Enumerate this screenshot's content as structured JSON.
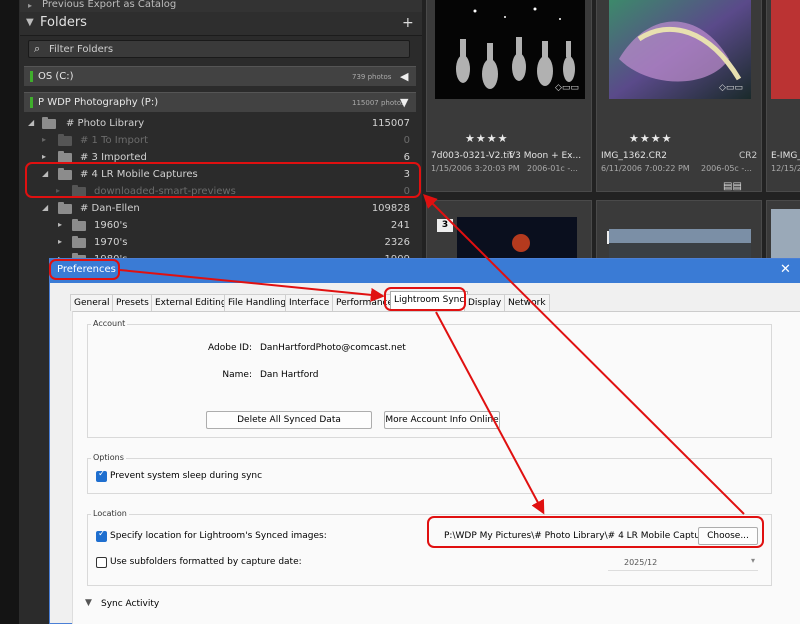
{
  "left_panel": {
    "prev_item": "Previous Export as Catalog",
    "folders_header": {
      "title": "Folders",
      "add_icon": "plus-icon"
    },
    "filter": {
      "placeholder": "Filter Folders",
      "icon": "search-icon"
    },
    "volumes": [
      {
        "name": "OS (C:)",
        "count": "739 photos",
        "led_color": "#3fae2c"
      },
      {
        "name": "P WDP Photography (P:)",
        "count": "115007 photos",
        "led_color": "#3fae2c"
      }
    ],
    "folder_rows": [
      {
        "label": "# Photo Library",
        "count": "115007"
      },
      {
        "label": "# 1 To Import",
        "count": "0"
      },
      {
        "label": "# 3 Imported",
        "count": "6"
      },
      {
        "label": "# 4 LR Mobile Captures",
        "count": "3"
      },
      {
        "label": "downloaded-smart-previews",
        "count": "0"
      },
      {
        "label": "# Dan-Ellen",
        "count": "109828"
      },
      {
        "label": "1960's",
        "count": "241"
      },
      {
        "label": "1970's",
        "count": "2326"
      },
      {
        "label": "1980's",
        "count": "1909"
      }
    ]
  },
  "grid": {
    "cells": [
      {
        "stars": "★★★★",
        "filename": "7d003-0321-V2.tif",
        "title": "V3 Moon + Ex...",
        "date": "1/15/2006 3:20:03 PM",
        "date2": "2006-01c -...",
        "ext": ""
      },
      {
        "stars": "★★★★",
        "filename": "IMG_1362.CR2",
        "title": "",
        "date": "6/11/2006 7:00:22 PM",
        "date2": "2006-05c -...",
        "ext": "CR2"
      },
      {
        "stars": "",
        "filename": "E-IMG_",
        "title": "",
        "date": "12/15/20",
        "date2": "",
        "ext": ""
      }
    ],
    "numbers": [
      "3",
      "2"
    ]
  },
  "prefs": {
    "title": "Preferences",
    "close_label": "✕",
    "tabs": [
      "General",
      "Presets",
      "External Editing",
      "File Handling",
      "Interface",
      "Performance",
      "Lightroom Sync",
      "Display",
      "Network"
    ],
    "active_tab": "Lightroom Sync",
    "account": {
      "group_title": "Account",
      "adobe_id_label": "Adobe ID:",
      "adobe_id": "DanHartfordPhoto@comcast.net",
      "name_label": "Name:",
      "name": "Dan Hartford",
      "delete_button": "Delete All Synced Data",
      "more_info_button": "More Account Info Online"
    },
    "options": {
      "group_title": "Options",
      "prevent_sleep_label": "Prevent system sleep during sync",
      "prevent_sleep": true
    },
    "location": {
      "group_title": "Location",
      "specify_label": "Specify location for Lightroom's Synced images:",
      "specify": true,
      "path": "P:\\WDP My Pictures\\# Photo Library\\# 4 LR Mobile Captures",
      "choose_button": "Choose...",
      "subfolders_label": "Use subfolders formatted by capture date:",
      "subfolders": false,
      "date_format": "2025/12"
    },
    "sync_activity": {
      "label": "Sync Activity"
    }
  },
  "annotation": {
    "color": "#e01010"
  }
}
